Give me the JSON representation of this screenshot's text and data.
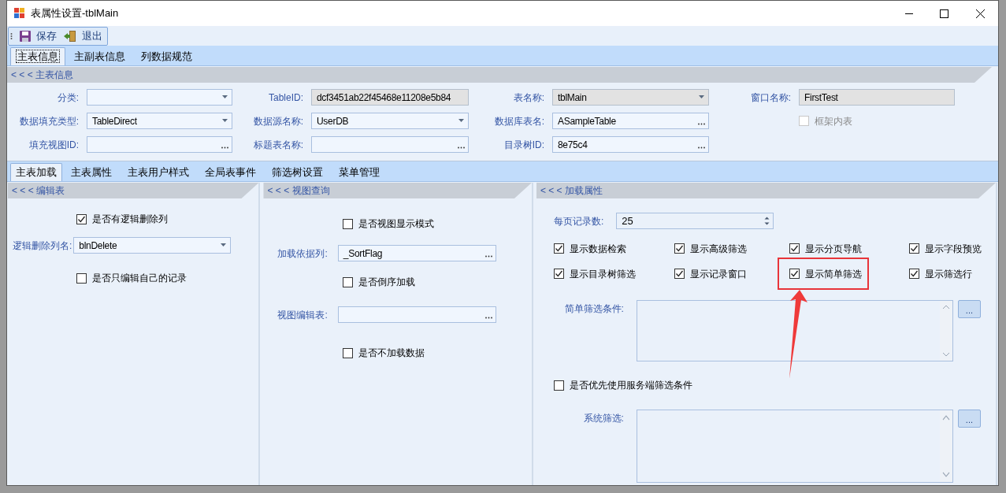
{
  "window": {
    "title": "表属性设置-tblMain"
  },
  "toolbar": {
    "buttons": [
      {
        "label": "保存",
        "kind": "save"
      },
      {
        "label": "退出",
        "kind": "exit"
      }
    ]
  },
  "top_tabs": [
    {
      "label": "主表信息",
      "selected": true
    },
    {
      "label": "主副表信息",
      "selected": false
    },
    {
      "label": "列数据规范",
      "selected": false
    }
  ],
  "main_section": {
    "title": "< < < 主表信息",
    "rows": [
      [
        {
          "label": "分类:",
          "kind": "combo",
          "readonly": false
        },
        {
          "label": "TableID:",
          "kind": "text",
          "value": "dcf3451ab22f45468e11208e5b84",
          "readonly": true
        },
        {
          "label": "表名称:",
          "kind": "combo",
          "value": "tblMain",
          "readonly": true
        },
        {
          "label": "窗口名称:",
          "kind": "text",
          "value": "FirstTest",
          "readonly": true
        }
      ],
      [
        {
          "label": "数据填充类型:",
          "kind": "combo",
          "value": "TableDirect",
          "readonly": false
        },
        {
          "label": "数据源名称:",
          "kind": "combo",
          "value": "UserDB",
          "readonly": false
        },
        {
          "label": "数据库表名:",
          "kind": "lookup",
          "value": "ASampleTable",
          "readonly": false
        },
        {
          "label": "框架内表",
          "kind": "checkbox",
          "checked": false,
          "disabled": true
        }
      ],
      [
        {
          "label": "填充视图ID:",
          "kind": "lookup",
          "readonly": false
        },
        {
          "label": "标题表名称:",
          "kind": "lookup",
          "readonly": false
        },
        {
          "label": "目录树ID:",
          "kind": "lookup",
          "value": "8e75c4",
          "readonly": false
        }
      ]
    ]
  },
  "sub_tabs": [
    {
      "label": "主表加载",
      "selected": true
    },
    {
      "label": "主表属性",
      "selected": false
    },
    {
      "label": "主表用户样式",
      "selected": false
    },
    {
      "label": "全局表事件",
      "selected": false
    },
    {
      "label": "筛选树设置",
      "selected": false
    },
    {
      "label": "菜单管理",
      "selected": false
    }
  ],
  "panels": [
    {
      "title": "< < < 编辑表",
      "items": [
        {
          "kind": "checkbox",
          "label": "是否有逻辑删除列",
          "checked": true
        },
        {
          "kind": "combo",
          "label": "逻辑删除列名:",
          "value": "blnDelete"
        },
        {
          "kind": "checkbox",
          "label": "是否只编辑自己的记录",
          "checked": false
        }
      ]
    },
    {
      "title": "< < < 视图查询",
      "items": [
        {
          "kind": "checkbox",
          "label": "是否视图显示模式",
          "checked": false
        },
        {
          "kind": "lookup",
          "label": "加载依据列:",
          "value": "_SortFlag"
        },
        {
          "kind": "checkbox",
          "label": "是否倒序加载",
          "checked": false
        },
        {
          "kind": "lookup",
          "label": "视图编辑表:"
        },
        {
          "kind": "checkbox",
          "label": "是否不加载数据",
          "checked": false
        }
      ]
    },
    {
      "title": "< < < 加载属性",
      "page_size": {
        "label": "每页记录数:",
        "value": "25"
      },
      "options": [
        {
          "label": "显示数据检索",
          "checked": true,
          "highlighted": false
        },
        {
          "label": "显示高级筛选",
          "checked": true,
          "highlighted": false
        },
        {
          "label": "显示分页导航",
          "checked": true,
          "highlighted": false
        },
        {
          "label": "显示字段预览",
          "checked": true,
          "highlighted": false
        },
        {
          "label": "显示目录树筛选",
          "checked": true,
          "highlighted": false
        },
        {
          "label": "显示记录窗口",
          "checked": true,
          "highlighted": false
        },
        {
          "label": "显示简单筛选",
          "checked": true,
          "highlighted": true
        },
        {
          "label": "显示筛选行",
          "checked": true,
          "highlighted": false
        }
      ],
      "simple_filter": {
        "label": "简单筛选条件:",
        "button": "..."
      },
      "prefer_server": {
        "label": "是否优先使用服务端筛选条件",
        "checked": false
      },
      "system_filter": {
        "label": "系统筛选:",
        "button": "..."
      }
    }
  ]
}
